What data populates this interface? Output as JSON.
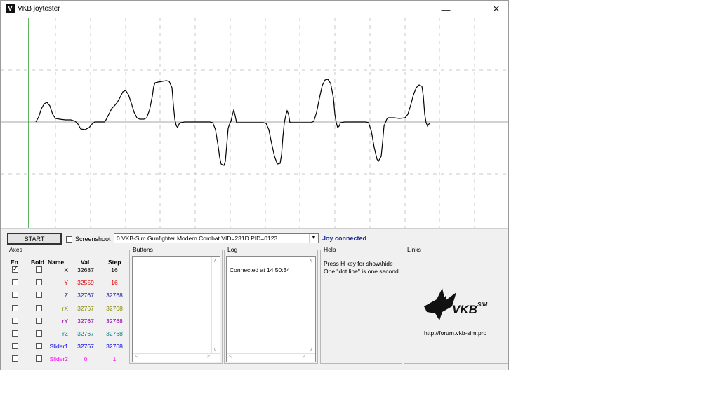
{
  "window": {
    "title": "VKB joytester"
  },
  "toolbar": {
    "start_label": "START",
    "screenshoot_label": "Screenshoot",
    "device": "0  VKB-Sim Gunfighter Modern Combat  VID=231D PID=0123",
    "status": "Joy connected"
  },
  "axes": {
    "title": "Axes",
    "headers": {
      "en": "En",
      "bold": "Bold",
      "name": "Name",
      "val": "Val",
      "step": "Step"
    },
    "rows": [
      {
        "name": "X",
        "val": "32687",
        "step": "16",
        "enabled": true,
        "color": "#000000"
      },
      {
        "name": "Y",
        "val": "32559",
        "step": "16",
        "enabled": false,
        "color": "#e00000"
      },
      {
        "name": "Z",
        "val": "32767",
        "step": "32768",
        "enabled": false,
        "color": "#1c1c9c"
      },
      {
        "name": "rX",
        "val": "32767",
        "step": "32768",
        "enabled": false,
        "color": "#8a8a00"
      },
      {
        "name": "rY",
        "val": "32767",
        "step": "32768",
        "enabled": false,
        "color": "#9400a8"
      },
      {
        "name": "rZ",
        "val": "32767",
        "step": "32768",
        "enabled": false,
        "color": "#008080"
      },
      {
        "name": "Slider1",
        "val": "32767",
        "step": "32768",
        "enabled": false,
        "color": "#0000e0"
      },
      {
        "name": "Slider2",
        "val": "0",
        "step": "1",
        "enabled": false,
        "color": "#ff00ff"
      }
    ]
  },
  "buttons_panel": {
    "title": "Buttons"
  },
  "log_panel": {
    "title": "Log",
    "lines": [
      "Connected at 14:50:34"
    ]
  },
  "help_panel": {
    "title": "Help",
    "lines": [
      "Press H key for show\\hide",
      "One \"dot line\" is one second"
    ]
  },
  "links_panel": {
    "title": "Links",
    "logo_text": "VKBSIM",
    "url": "http://forum.vkb-sim.pro"
  },
  "graph": {
    "cursor_color": "#2a9d2a",
    "trace_color": "#000000"
  }
}
